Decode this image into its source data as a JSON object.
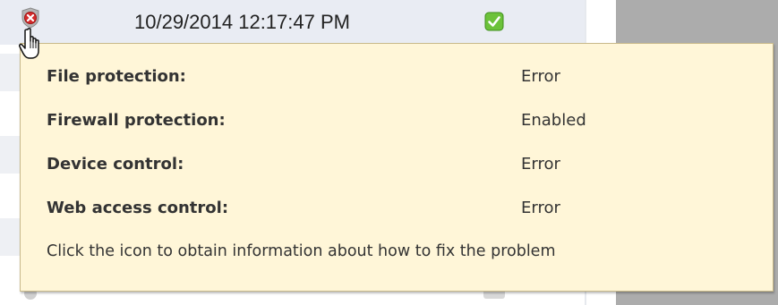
{
  "row": {
    "timestamp": "10/29/2014 12:17:47 PM",
    "status_icon": "shield-error-icon",
    "check_icon": "check-icon"
  },
  "tooltip": {
    "items": [
      {
        "label": "File protection:",
        "value": "Error"
      },
      {
        "label": "Firewall protection:",
        "value": "Enabled"
      },
      {
        "label": "Device control:",
        "value": "Error"
      },
      {
        "label": "Web access control:",
        "value": "Error"
      }
    ],
    "hint": "Click the icon to obtain information about how to fix the problem"
  },
  "colors": {
    "tooltip_background": "#fff6d8",
    "tooltip_border": "#c8b98a",
    "error_red": "#cc2222",
    "check_green": "#5cb82e",
    "side_panel": "#acacac"
  }
}
